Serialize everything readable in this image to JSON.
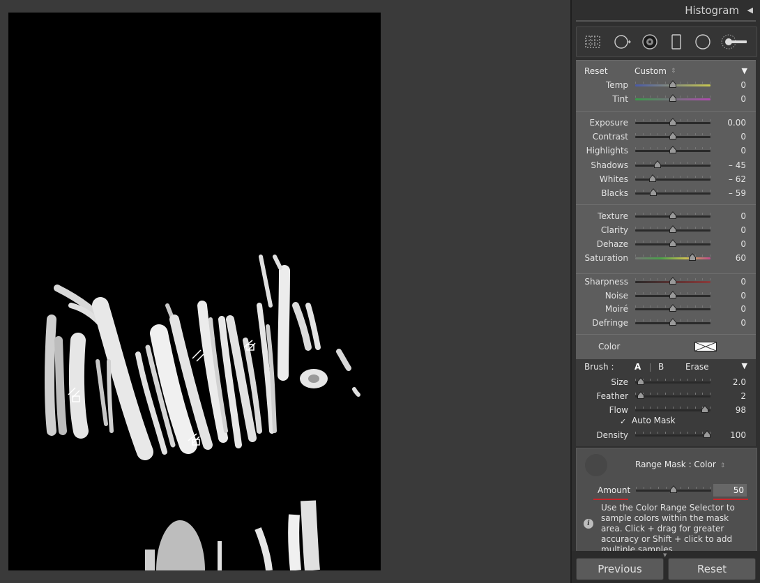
{
  "panel": {
    "title": "Histogram",
    "collapse_icon": "triangle-left-icon",
    "tools": [
      "crop-overlay-icon",
      "spot-removal-icon",
      "red-eye-icon",
      "graduated-filter-icon",
      "radial-filter-icon",
      "adjustment-brush-icon"
    ]
  },
  "effect": {
    "reset": "Reset",
    "preset": "Custom"
  },
  "sliders": [
    {
      "label": "Temp",
      "value": "0",
      "pos": 0.5,
      "track": "temp"
    },
    {
      "label": "Tint",
      "value": "0",
      "pos": 0.5,
      "track": "tint"
    },
    {
      "label": "Exposure",
      "value": "0.00",
      "pos": 0.5,
      "track": "gray"
    },
    {
      "label": "Contrast",
      "value": "0",
      "pos": 0.5,
      "track": "gray"
    },
    {
      "label": "Highlights",
      "value": "0",
      "pos": 0.5,
      "track": "gray"
    },
    {
      "label": "Shadows",
      "value": "– 45",
      "pos": 0.3,
      "track": "gray"
    },
    {
      "label": "Whites",
      "value": "– 62",
      "pos": 0.23,
      "track": "gray"
    },
    {
      "label": "Blacks",
      "value": "– 59",
      "pos": 0.24,
      "track": "gray"
    },
    {
      "label": "Texture",
      "value": "0",
      "pos": 0.5,
      "track": "gray"
    },
    {
      "label": "Clarity",
      "value": "0",
      "pos": 0.5,
      "track": "gray"
    },
    {
      "label": "Dehaze",
      "value": "0",
      "pos": 0.5,
      "track": "gray"
    },
    {
      "label": "Saturation",
      "value": "60",
      "pos": 0.76,
      "track": "saturation"
    },
    {
      "label": "Sharpness",
      "value": "0",
      "pos": 0.5,
      "track": "sharpness"
    },
    {
      "label": "Noise",
      "value": "0",
      "pos": 0.5,
      "track": "gray"
    },
    {
      "label": "Moiré",
      "value": "0",
      "pos": 0.5,
      "track": "gray"
    },
    {
      "label": "Defringe",
      "value": "0",
      "pos": 0.5,
      "track": "gray"
    }
  ],
  "color": {
    "label": "Color",
    "swatch": "#fafafa"
  },
  "brush": {
    "label": "Brush :",
    "a": "A",
    "b": "B",
    "erase": "Erase",
    "sliders": [
      {
        "label": "Size",
        "value": "2.0",
        "pos": 0.07
      },
      {
        "label": "Feather",
        "value": "2",
        "pos": 0.07
      },
      {
        "label": "Flow",
        "value": "98",
        "pos": 0.93
      }
    ],
    "auto_mask": "Auto Mask",
    "density": {
      "label": "Density",
      "value": "100",
      "pos": 0.95
    }
  },
  "range_mask": {
    "label": "Range Mask : Color",
    "amount_label": "Amount",
    "amount_value": "50",
    "amount_pos": 0.5,
    "info": "Use the Color Range Selector to sample colors within the mask area. Click + drag for greater accuracy or Shift + click to add multiple samples."
  },
  "buttons": {
    "previous": "Previous",
    "reset": "Reset"
  }
}
